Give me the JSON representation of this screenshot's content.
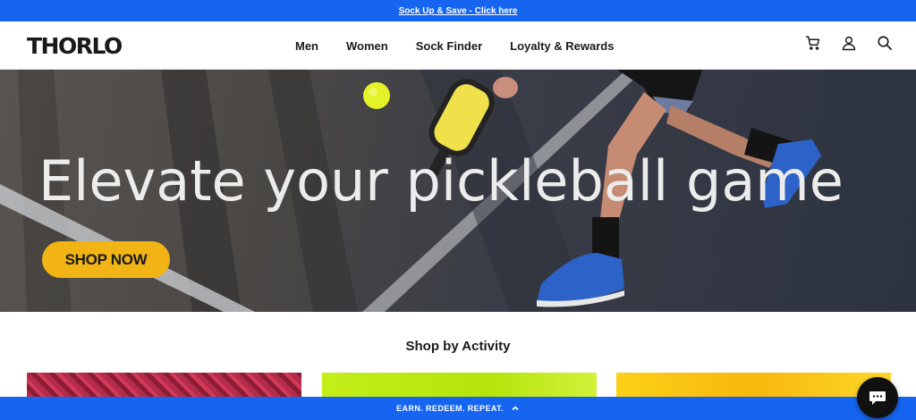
{
  "announcement": {
    "text": "Sock Up & Save - Click here"
  },
  "header": {
    "logo": "THORLO",
    "nav": [
      "Men",
      "Women",
      "Sock Finder",
      "Loyalty & Rewards"
    ],
    "icons": [
      "cart-icon",
      "account-icon",
      "search-icon"
    ]
  },
  "hero": {
    "title": "Elevate your pickleball game",
    "cta": "SHOP NOW"
  },
  "activity": {
    "title": "Shop by Activity"
  },
  "footer_bar": {
    "text": "EARN. REDEEM. REPEAT.",
    "icon": "chevron-up-icon"
  },
  "chat": {
    "icon": "chat-bubble-icon"
  },
  "colors": {
    "brand_blue": "#1565f0",
    "cta_yellow": "#f1b414"
  }
}
